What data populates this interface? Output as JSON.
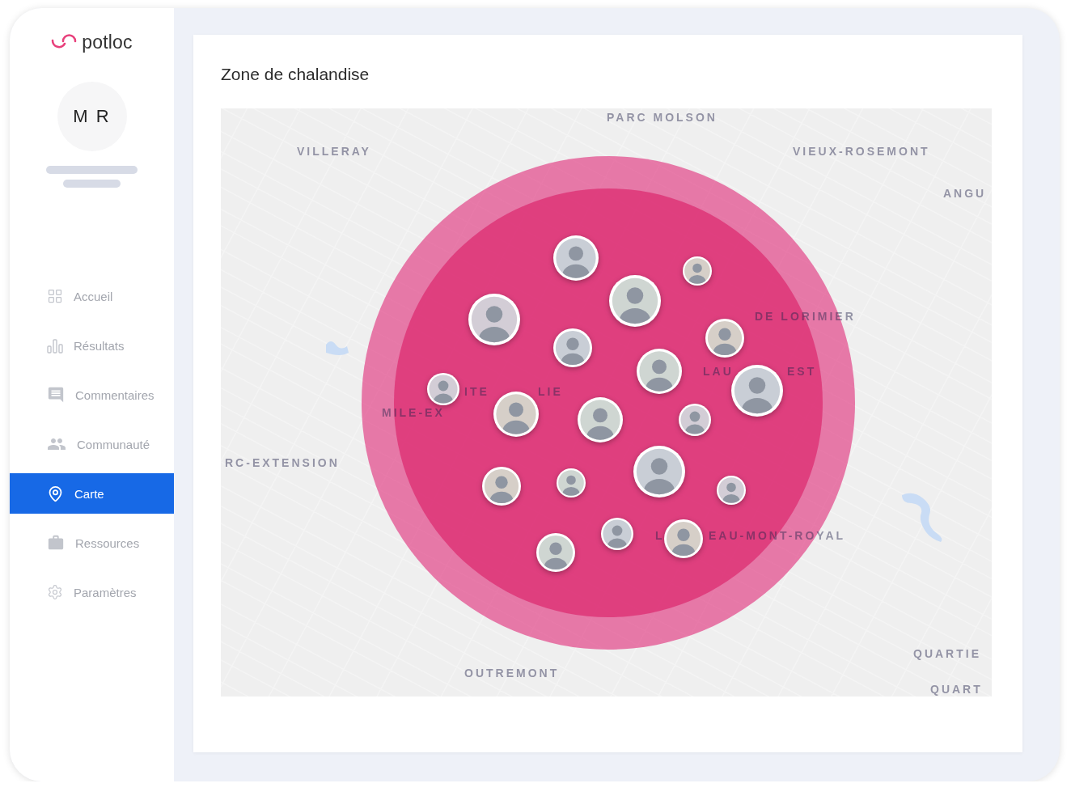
{
  "logo": {
    "text": "potloc"
  },
  "profile": {
    "initials": "M R"
  },
  "nav": [
    {
      "label": "Accueil",
      "selected": false
    },
    {
      "label": "Résultats",
      "selected": false
    },
    {
      "label": "Commentaires",
      "selected": false
    },
    {
      "label": "Communauté",
      "selected": false
    },
    {
      "label": "Carte",
      "selected": true
    },
    {
      "label": "Ressources",
      "selected": false
    },
    {
      "label": "Paramètres",
      "selected": false
    }
  ],
  "page": {
    "title": "Zone de chalandise"
  },
  "map": {
    "labels": [
      "PARC MOLSON",
      "VILLERAY",
      "VIEUX-ROSEMONT",
      "ANGU",
      "DE LORIMIER",
      "LAU",
      "EST",
      "ITE",
      "LIE",
      "MILE-EX",
      "RC-EXTENSION",
      "L",
      "EAU-MONT-ROYAL",
      "OUTREMONT",
      "QUARTIE",
      "QUART"
    ]
  }
}
